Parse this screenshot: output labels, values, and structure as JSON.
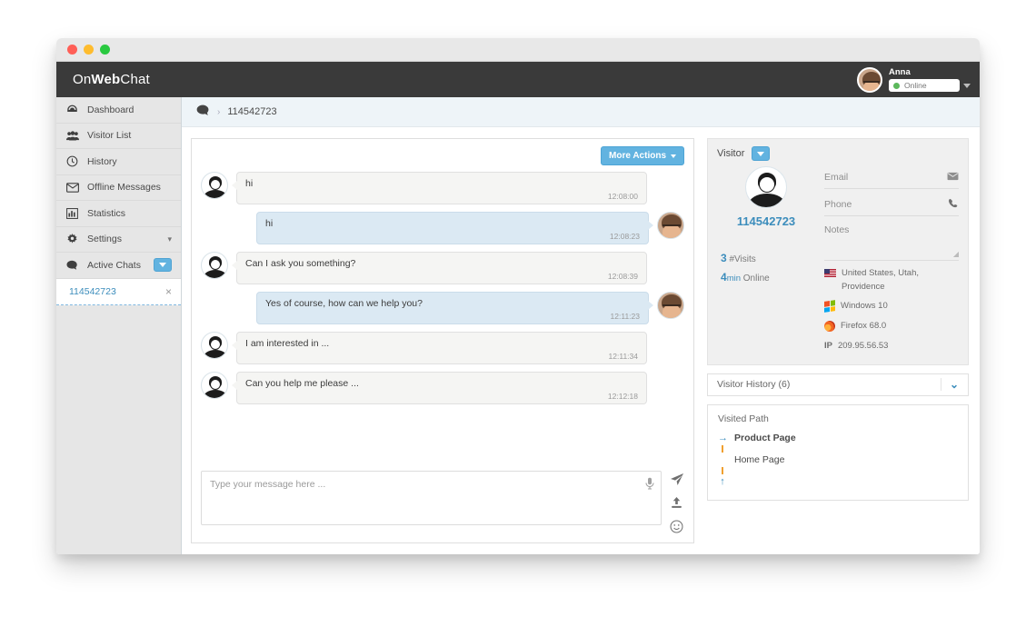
{
  "app": {
    "logo_on": "On",
    "logo_web": "Web",
    "logo_chat": "Chat",
    "user_name": "Anna",
    "user_status": "Online"
  },
  "sidebar": {
    "items": [
      {
        "label": "Dashboard",
        "icon": "dashboard-icon"
      },
      {
        "label": "Visitor List",
        "icon": "users-icon"
      },
      {
        "label": "History",
        "icon": "clock-icon"
      },
      {
        "label": "Offline Messages",
        "icon": "envelope-icon"
      },
      {
        "label": "Statistics",
        "icon": "bar-chart-icon"
      },
      {
        "label": "Settings",
        "icon": "gear-icon"
      },
      {
        "label": "Active Chats",
        "icon": "chat-bubble-icon"
      }
    ],
    "active_chat": {
      "label": "114542723",
      "close": "×"
    }
  },
  "breadcrumb": {
    "icon": "chat-bubble-icon",
    "separator": "›",
    "current": "114542723"
  },
  "chat": {
    "more_actions_label": "More Actions",
    "messages": [
      {
        "side": "in",
        "text": "hi",
        "time": "12:08:00"
      },
      {
        "side": "out",
        "text": "hi",
        "time": "12:08:23"
      },
      {
        "side": "in",
        "text": "Can I ask you something?",
        "time": "12:08:39"
      },
      {
        "side": "out",
        "text": "Yes of course, how can we help you?",
        "time": "12:11:23"
      },
      {
        "side": "in",
        "text": "I am interested in ...",
        "time": "12:11:34"
      },
      {
        "side": "in",
        "text": "Can you help me please ...",
        "time": "12:12:18"
      }
    ],
    "composer": {
      "placeholder": "Type your message here ...",
      "value": "",
      "mic_icon": "microphone-icon",
      "send_icon": "➤",
      "upload_icon": "⇧",
      "emoji_icon": "☺"
    }
  },
  "visitor": {
    "panel_title": "Visitor",
    "id": "114542723",
    "fields": [
      {
        "label": "Email",
        "icon": "envelope-icon"
      },
      {
        "label": "Phone",
        "icon": "phone-icon"
      },
      {
        "label": "Notes",
        "icon": ""
      }
    ],
    "visits_count": "3",
    "visits_label": "#Visits",
    "online_count": "4",
    "online_unit": "min",
    "online_label": "Online",
    "location": "United States, Utah, Providence",
    "os": "Windows 10",
    "browser": "Firefox 68.0",
    "ip_label": "IP",
    "ip": "209.95.56.53",
    "history_title": "Visitor History (6)",
    "visited_path_title": "Visited Path",
    "visited_path": [
      {
        "label": "Product Page",
        "marker": "arrow-right-icon",
        "bold": true
      },
      {
        "label": "Home Page",
        "marker": "dot-icon",
        "bold": false
      }
    ],
    "path_end_icon": "arrow-up-icon"
  }
}
